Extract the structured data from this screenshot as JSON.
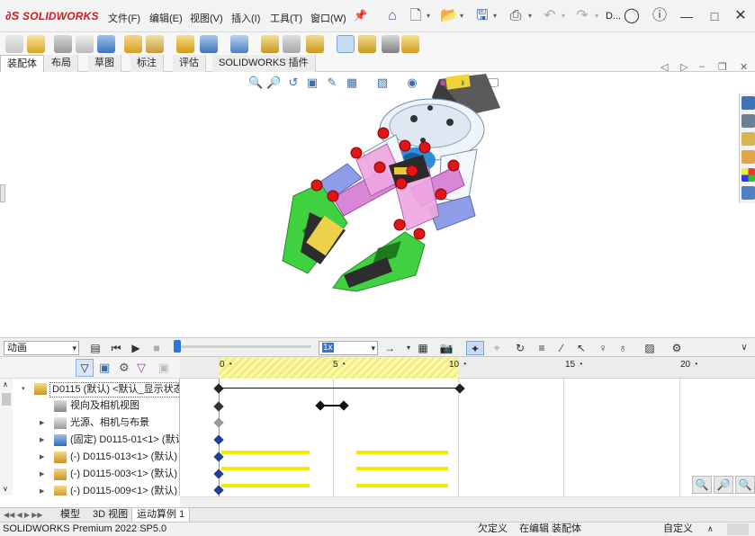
{
  "app": {
    "brand": "SOLIDWORKS",
    "menus": [
      "文件(F)",
      "编辑(E)",
      "视图(V)",
      "插入(I)",
      "工具(T)",
      "窗口(W)"
    ],
    "document_short": "D..."
  },
  "tabs": [
    "装配体",
    "布局",
    "草图",
    "标注",
    "评估",
    "SOLIDWORKS 插件"
  ],
  "motion": {
    "study_type": "动画",
    "speed": "1x",
    "ruler": [
      "0",
      "5",
      "10",
      "15",
      "20"
    ]
  },
  "tree": {
    "root": "D0115 (默认) <默认_显示状态",
    "items": [
      "视向及相机视图",
      "光源、相机与布景",
      "(固定) D0115-01<1> (默认",
      "(-) D0115-013<1> (默认)",
      "(-) D0115-003<1> (默认)",
      "(-) D0115-009<1> (默认)"
    ]
  },
  "bottom_tabs": [
    "模型",
    "3D 视图",
    "运动算例 1"
  ],
  "status": {
    "product": "SOLIDWORKS Premium 2022 SP5.0",
    "defined": "欠定义",
    "editing": "在编辑 装配体",
    "custom": "自定义"
  },
  "colors": {
    "brand": "#d01c1f",
    "accent": "#2b5fa7",
    "timeline_keys": "#f3ea00"
  }
}
